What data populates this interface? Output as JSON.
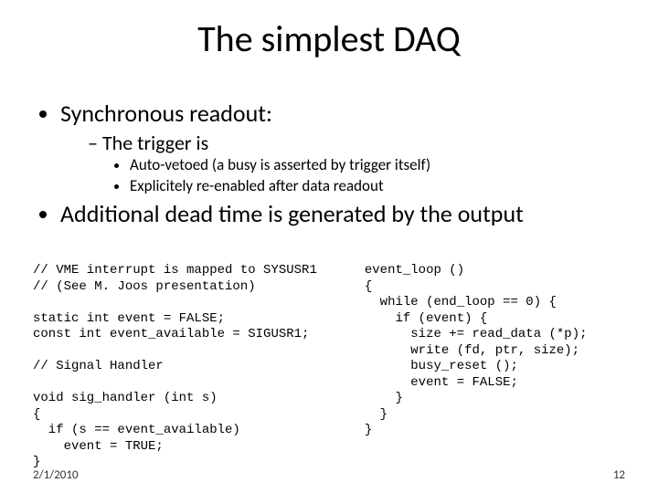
{
  "title": "The simplest DAQ",
  "bullets": {
    "b1": "Synchronous readout:",
    "b1_1": "The trigger is",
    "b1_1_1": "Auto-vetoed (a busy is asserted by trigger itself)",
    "b1_1_2": "Explicitely re-enabled after data readout",
    "b2": "Additional dead time is generated by the output"
  },
  "code_left": "// VME interrupt is mapped to SYSUSR1\n// (See M. Joos presentation)\n\nstatic int event = FALSE;\nconst int event_available = SIGUSR1;\n\n// Signal Handler\n\nvoid sig_handler (int s)\n{\n  if (s == event_available)\n    event = TRUE;\n}",
  "code_right": "event_loop ()\n{\n  while (end_loop == 0) {\n    if (event) {\n      size += read_data (*p);\n      write (fd, ptr, size);\n      busy_reset ();\n      event = FALSE;\n    }\n  }\n}",
  "footer": {
    "date": "2/1/2010",
    "page": "12"
  }
}
